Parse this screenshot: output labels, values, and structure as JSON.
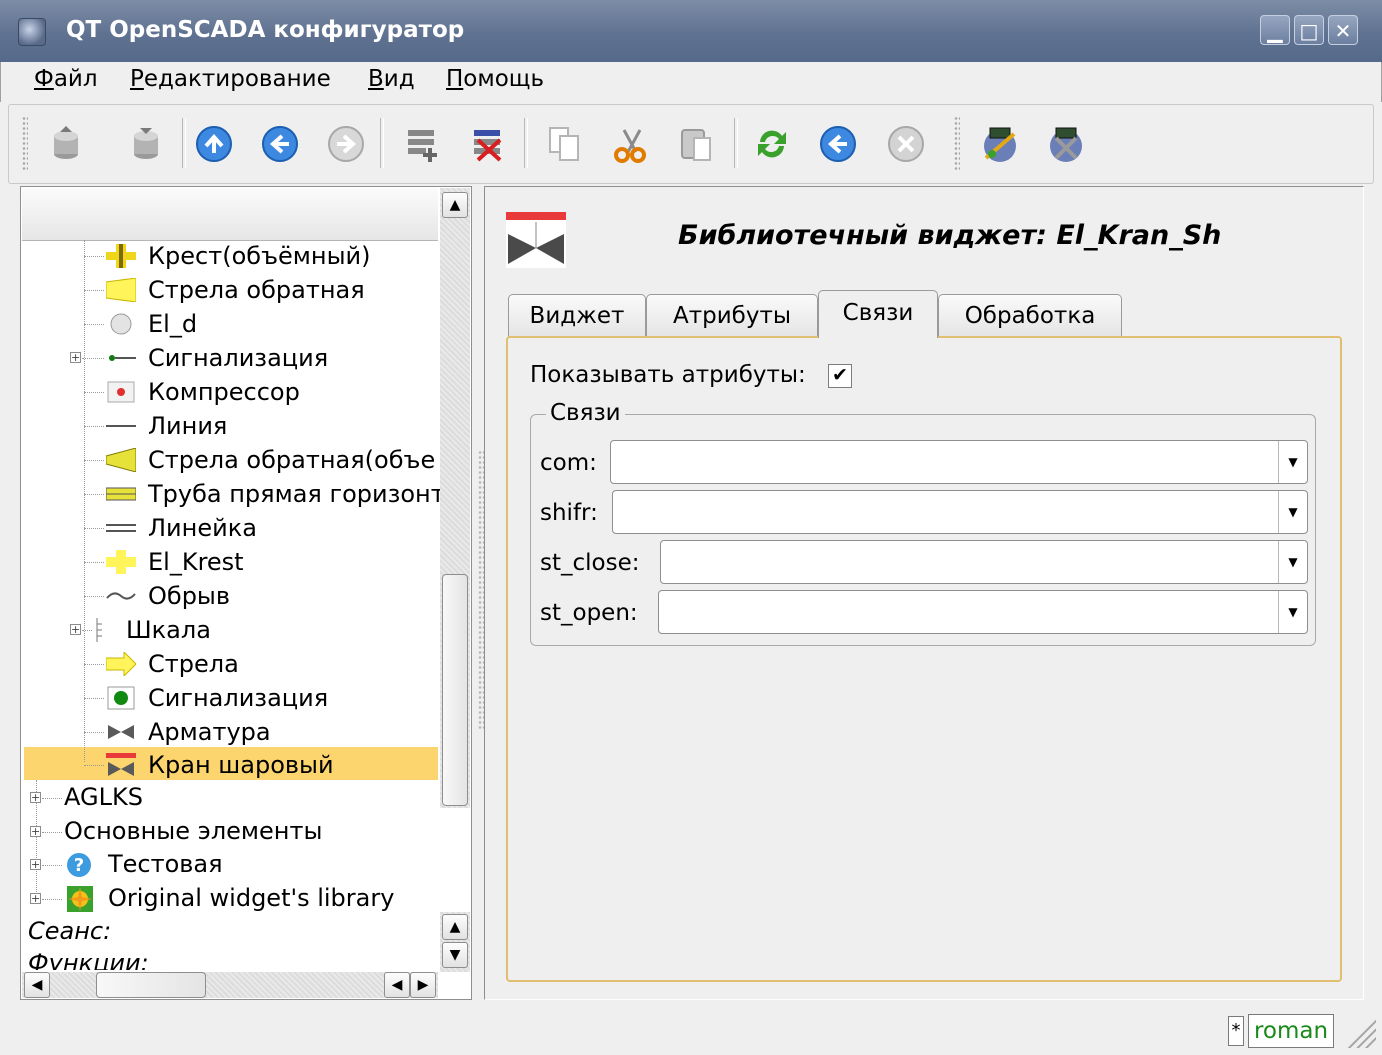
{
  "window": {
    "title": "QT OpenSCADA конфигуратор"
  },
  "menu": [
    "Файл",
    "Редактирование",
    "Вид",
    "Помощь"
  ],
  "toolbar_icons": [
    "db-load-icon",
    "db-save-icon",
    "up-icon",
    "back-icon",
    "forward-icon",
    "add-item-icon",
    "delete-item-icon",
    "copy-icon",
    "cut-icon",
    "paste-icon",
    "refresh-icon",
    "start-icon",
    "stop-icon",
    "vision-editor-icon",
    "vision-runtime-icon"
  ],
  "tree": {
    "items": [
      {
        "label": "Крест(объёмный)",
        "icon": "cross-3d-icon"
      },
      {
        "label": "Стрела обратная",
        "icon": "reverse-arrow-icon"
      },
      {
        "label": "El_d",
        "icon": "circle-icon"
      },
      {
        "label": "Сигнализация",
        "icon": "signal-line-icon",
        "expandable": true
      },
      {
        "label": "Компрессор",
        "icon": "compressor-icon"
      },
      {
        "label": "Линия",
        "icon": "line-icon"
      },
      {
        "label": "Стрела обратная(объе",
        "icon": "reverse-arrow-3d-icon"
      },
      {
        "label": "Труба прямая горизонт",
        "icon": "pipe-icon"
      },
      {
        "label": "Линейка",
        "icon": "ruler-icon"
      },
      {
        "label": "El_Krest",
        "icon": "cross-icon"
      },
      {
        "label": "Обрыв",
        "icon": "break-icon"
      },
      {
        "label": "Шкала",
        "icon": "scale-icon",
        "expandable": true
      },
      {
        "label": "Стрела",
        "icon": "arrow-icon"
      },
      {
        "label": "Сигнализация",
        "icon": "signal-lamp-icon"
      },
      {
        "label": "Арматура",
        "icon": "valve-icon"
      },
      {
        "label": "Кран шаровый",
        "icon": "ball-valve-icon",
        "selected": true
      }
    ],
    "root_items": [
      {
        "label": "AGLKS"
      },
      {
        "label": "Основные элементы"
      },
      {
        "label": "Тестовая",
        "icon": "help-icon"
      },
      {
        "label": "Original widget's library",
        "icon": "library-icon"
      }
    ],
    "sections": [
      "Сеанс:",
      "Функции:"
    ]
  },
  "detail": {
    "title": "Библиотечный виджет: El_Kran_Sh",
    "tabs": [
      "Виджет",
      "Атрибуты",
      "Связи",
      "Обработка"
    ],
    "active_tab": "Связи",
    "show_attributes_label": "Показывать атрибуты:",
    "show_attributes_checked": true,
    "links_group_title": "Связи",
    "links": [
      {
        "label": "com:",
        "value": ""
      },
      {
        "label": "shifr:",
        "value": ""
      },
      {
        "label": "st_close:",
        "value": ""
      },
      {
        "label": "st_open:",
        "value": ""
      }
    ]
  },
  "status": {
    "modified_marker": "*",
    "user": "roman"
  },
  "colors": {
    "title_bar": "#5f7291",
    "selection": "#fcd56f",
    "tab_frame": "#e0c070",
    "user_text": "#1b8a1b"
  }
}
